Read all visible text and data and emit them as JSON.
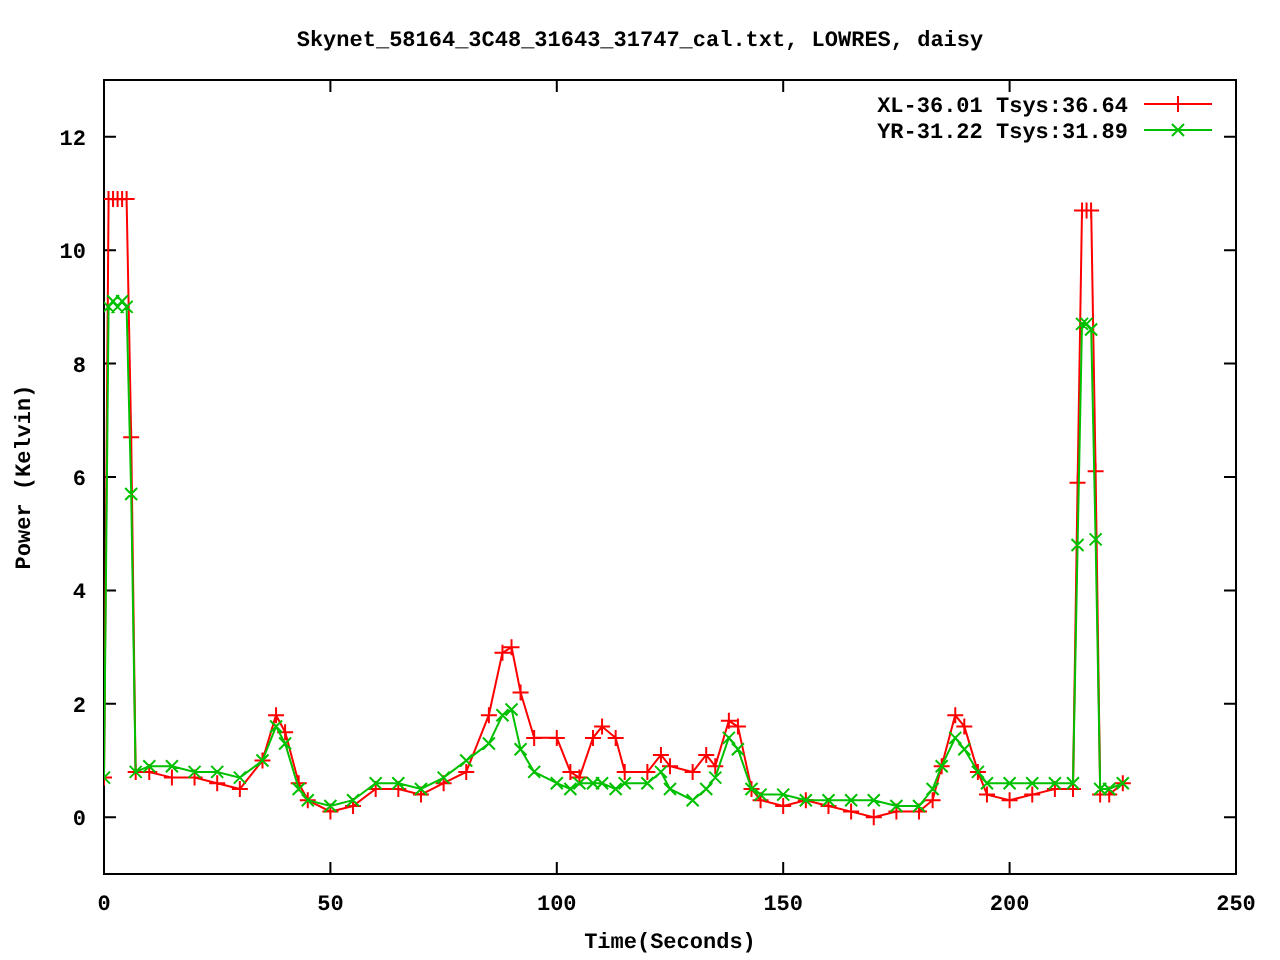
{
  "chart_data": {
    "type": "line",
    "title": "Skynet_58164_3C48_31643_31747_cal.txt, LOWRES, daisy",
    "xlabel": "Time(Seconds)",
    "ylabel": "Power (Kelvin)",
    "xlim": [
      0,
      250
    ],
    "ylim": [
      -1,
      13
    ],
    "xticks": [
      0,
      50,
      100,
      150,
      200,
      250
    ],
    "yticks": [
      0,
      2,
      4,
      6,
      8,
      10,
      12
    ],
    "legend": true,
    "x": [
      0,
      1,
      2,
      3,
      4,
      5,
      6,
      7,
      10,
      15,
      20,
      25,
      30,
      35,
      38,
      40,
      43,
      45,
      50,
      55,
      60,
      65,
      70,
      75,
      80,
      85,
      88,
      90,
      92,
      95,
      100,
      103,
      105,
      108,
      110,
      113,
      115,
      120,
      123,
      125,
      130,
      133,
      135,
      138,
      140,
      143,
      145,
      150,
      155,
      160,
      165,
      170,
      175,
      180,
      183,
      185,
      188,
      190,
      193,
      195,
      200,
      205,
      210,
      214,
      215,
      216,
      217,
      218,
      219,
      220,
      222,
      225
    ],
    "series": [
      {
        "name": "XL-36.01 Tsys:36.64",
        "color": "#ff0000",
        "marker": "plus",
        "values": [
          0.7,
          10.9,
          10.9,
          10.9,
          10.9,
          10.9,
          6.7,
          0.8,
          0.8,
          0.7,
          0.7,
          0.6,
          0.5,
          1.0,
          1.8,
          1.5,
          0.6,
          0.3,
          0.1,
          0.2,
          0.5,
          0.5,
          0.4,
          0.6,
          0.8,
          1.8,
          2.9,
          3.0,
          2.2,
          1.4,
          1.4,
          0.8,
          0.7,
          1.4,
          1.6,
          1.4,
          0.8,
          0.8,
          1.1,
          0.9,
          0.8,
          1.1,
          0.9,
          1.7,
          1.6,
          0.5,
          0.3,
          0.2,
          0.3,
          0.2,
          0.1,
          0.0,
          0.1,
          0.1,
          0.3,
          0.9,
          1.8,
          1.6,
          0.8,
          0.4,
          0.3,
          0.4,
          0.5,
          0.5,
          5.9,
          10.7,
          10.7,
          10.7,
          6.1,
          0.4,
          0.4,
          0.6
        ]
      },
      {
        "name": "YR-31.22 Tsys:31.89",
        "color": "#00c000",
        "marker": "cross",
        "values": [
          0.7,
          9.0,
          9.1,
          9.0,
          9.1,
          9.0,
          5.7,
          0.8,
          0.9,
          0.9,
          0.8,
          0.8,
          0.7,
          1.0,
          1.6,
          1.3,
          0.5,
          0.3,
          0.2,
          0.3,
          0.6,
          0.6,
          0.5,
          0.7,
          1.0,
          1.3,
          1.8,
          1.9,
          1.2,
          0.8,
          0.6,
          0.5,
          0.6,
          0.6,
          0.6,
          0.5,
          0.6,
          0.6,
          0.8,
          0.5,
          0.3,
          0.5,
          0.7,
          1.4,
          1.2,
          0.5,
          0.4,
          0.4,
          0.3,
          0.3,
          0.3,
          0.3,
          0.2,
          0.2,
          0.5,
          0.9,
          1.4,
          1.2,
          0.8,
          0.6,
          0.6,
          0.6,
          0.6,
          0.6,
          4.8,
          8.7,
          8.7,
          8.6,
          4.9,
          0.5,
          0.5,
          0.6
        ]
      }
    ]
  }
}
